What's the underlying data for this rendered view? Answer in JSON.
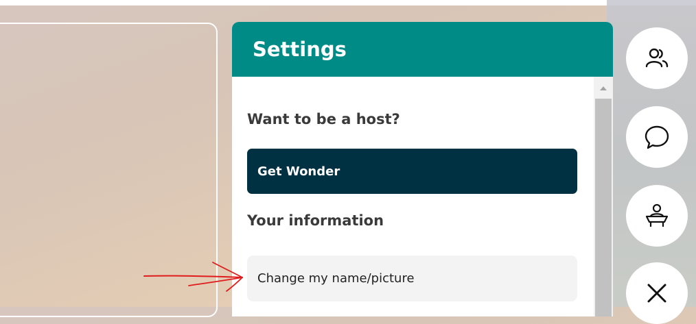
{
  "settings_panel": {
    "title": "Settings",
    "host_section": {
      "heading": "Want to be a host?",
      "get_wonder_label": "Get Wonder"
    },
    "info_section": {
      "heading": "Your information",
      "change_name_label": "Change my name/picture"
    }
  },
  "side_toolbar": {
    "buttons": [
      {
        "icon": "people-icon"
      },
      {
        "icon": "chat-icon"
      },
      {
        "icon": "desk-user-icon"
      },
      {
        "icon": "close-icon"
      }
    ]
  },
  "colors": {
    "header": "#008b87",
    "primary_button": "#003142",
    "annotation": "#e01b1b"
  }
}
